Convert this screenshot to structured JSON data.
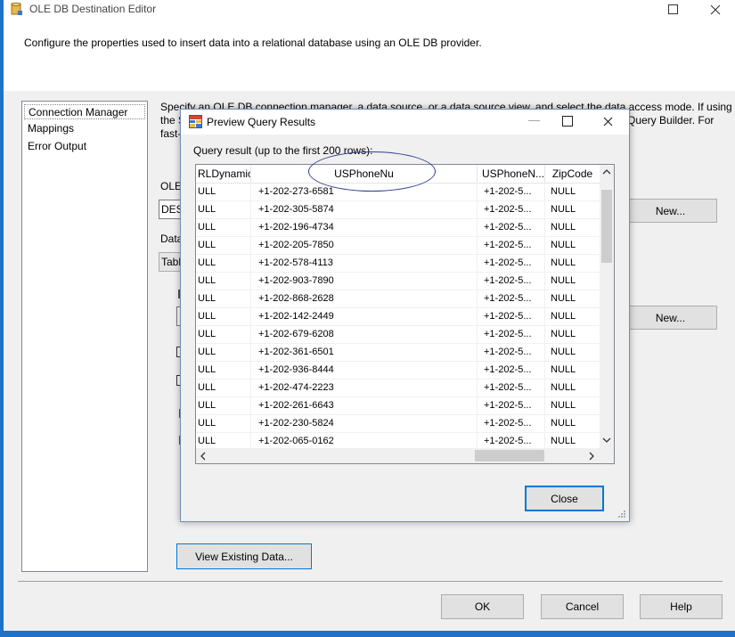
{
  "window": {
    "title": "OLE DB Destination Editor",
    "description": "Configure the properties used to insert data into a relational database using an OLE DB provider."
  },
  "nav": [
    "Connection Manager",
    "Mappings",
    "Error Output"
  ],
  "right_text": {
    "line1a": "Specify an OLE DB connection manager, a data source, or a data source view, and select the data access mode. If using",
    "line2a": "the S",
    "line2b": "Query Builder. For",
    "line3a": "fast-",
    "ole_label": "OLE",
    "des_value": "DES",
    "data_label": "Data",
    "table_value": "Tabl"
  },
  "buttons": {
    "new1": "New...",
    "new2": "New...",
    "view_existing": "View Existing Data...",
    "ok": "OK",
    "cancel": "Cancel",
    "help": "Help",
    "close": "Close"
  },
  "preview": {
    "title": "Preview Query Results",
    "caption": "Query result (up to the first 200 rows):",
    "columns": [
      "RLDynamic",
      "USPhoneNu",
      "USPhoneN...",
      "ZipCode"
    ],
    "rows": [
      [
        "ULL",
        "+1-202-273-6581",
        "+1-202-5...",
        "NULL"
      ],
      [
        "ULL",
        "+1-202-305-5874",
        "+1-202-5...",
        "NULL"
      ],
      [
        "ULL",
        "+1-202-196-4734",
        "+1-202-5...",
        "NULL"
      ],
      [
        "ULL",
        "+1-202-205-7850",
        "+1-202-5...",
        "NULL"
      ],
      [
        "ULL",
        "+1-202-578-4113",
        "+1-202-5...",
        "NULL"
      ],
      [
        "ULL",
        "+1-202-903-7890",
        "+1-202-5...",
        "NULL"
      ],
      [
        "ULL",
        "+1-202-868-2628",
        "+1-202-5...",
        "NULL"
      ],
      [
        "ULL",
        "+1-202-142-2449",
        "+1-202-5...",
        "NULL"
      ],
      [
        "ULL",
        "+1-202-679-6208",
        "+1-202-5...",
        "NULL"
      ],
      [
        "ULL",
        "+1-202-361-6501",
        "+1-202-5...",
        "NULL"
      ],
      [
        "ULL",
        "+1-202-936-8444",
        "+1-202-5...",
        "NULL"
      ],
      [
        "ULL",
        "+1-202-474-2223",
        "+1-202-5...",
        "NULL"
      ],
      [
        "ULL",
        "+1-202-261-6643",
        "+1-202-5...",
        "NULL"
      ],
      [
        "ULL",
        "+1-202-230-5824",
        "+1-202-5...",
        "NULL"
      ],
      [
        "ULL",
        "+1-202-065-0162",
        "+1-202-5...",
        "NULL"
      ]
    ]
  }
}
